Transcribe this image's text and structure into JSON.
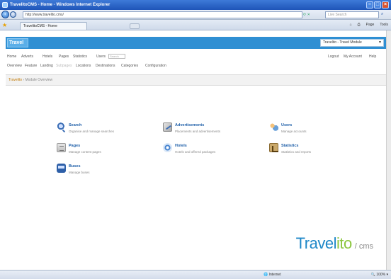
{
  "window": {
    "title": "TravelitoCMS - Home - Windows Internet Explorer"
  },
  "browser": {
    "url": "http://www.travelito.cms/",
    "search_placeholder": "Live Search",
    "tab_label": "TravelitoCMS - Home",
    "commands": [
      "Page",
      "Tools"
    ],
    "status_zone": "Internet",
    "status_zoom": "100%"
  },
  "header": {
    "logo": "Travel",
    "language": "Travelito - Travel Module"
  },
  "menu_primary": {
    "items": [
      "Home",
      "Adverts",
      "Hotels",
      "Pages",
      "Statistics",
      "Users"
    ],
    "search_placeholder": "Search",
    "right": [
      "Logout",
      "My Account",
      "Help"
    ]
  },
  "menu_secondary": {
    "items": [
      "Overview",
      "Feature",
      "Landing",
      "Subpages",
      "Locations",
      "Destinations",
      "Categories",
      "Configuration"
    ]
  },
  "breadcrumb": {
    "root": "Travelito",
    "current": "Module Overview"
  },
  "modules": [
    {
      "icon": "search-icon",
      "title": "Search",
      "desc": "Organise and manage searches"
    },
    {
      "icon": "pages-icon",
      "title": "Pages",
      "desc": "Manage content pages"
    },
    {
      "icon": "bus-icon",
      "title": "Buses",
      "desc": "Manage buses"
    },
    {
      "icon": "advert-icon",
      "title": "Advertisements",
      "desc": "Placements and advertisements"
    },
    {
      "icon": "hotel-icon",
      "title": "Hotels",
      "desc": "Hotels and offered packages"
    },
    {
      "icon": "users-icon",
      "title": "Users",
      "desc": "Manage accounts"
    },
    {
      "icon": "stats-icon",
      "title": "Statistics",
      "desc": "Statistics and reports"
    }
  ],
  "brand": {
    "part1": "Travel",
    "part2": "ito",
    "suffix": "/ cms"
  },
  "colors": {
    "header_blue": "#2f8fd3",
    "link_blue": "#1d5ea8",
    "brand_blue": "#1f88c8",
    "brand_green": "#8cc63f"
  }
}
